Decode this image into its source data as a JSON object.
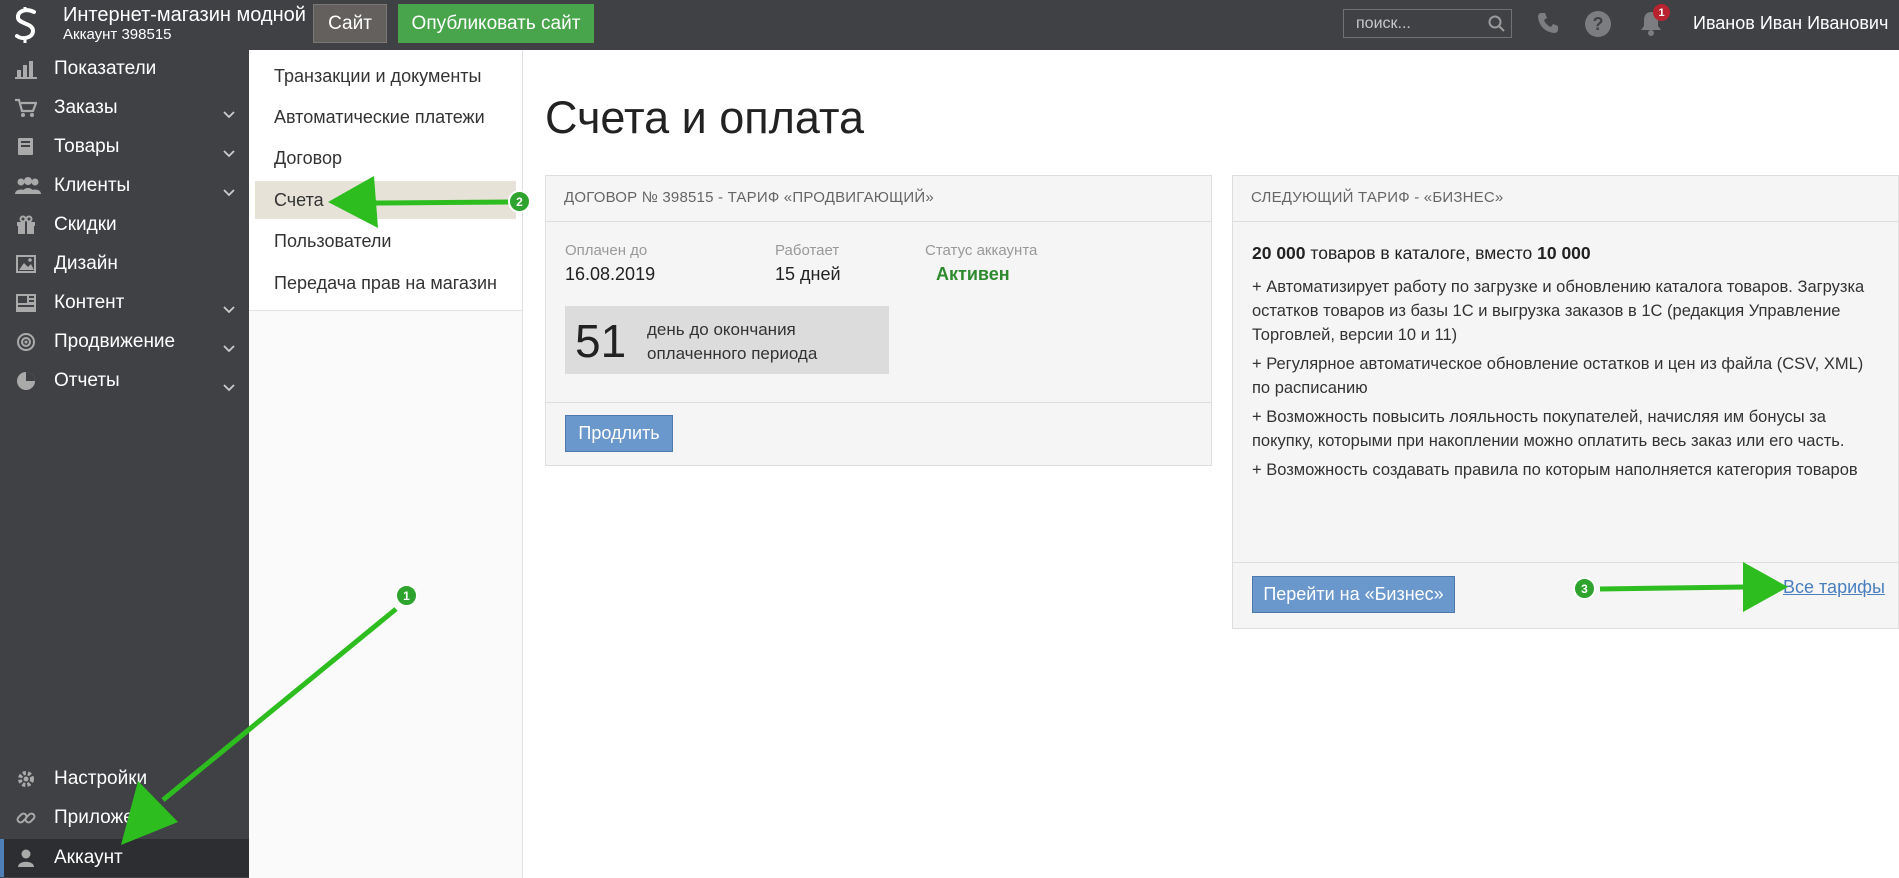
{
  "topbar": {
    "store_name": "Интернет-магазин модной",
    "account_label": "Аккаунт 398515",
    "site_button": "Сайт",
    "publish_button": "Опубликовать сайт",
    "search_placeholder": "поиск...",
    "notifications_count": "1",
    "user_name": "Иванов Иван Иванович"
  },
  "sidebar": {
    "items": [
      {
        "label": "Показатели",
        "icon": "chart-icon"
      },
      {
        "label": "Заказы",
        "icon": "cart-icon"
      },
      {
        "label": "Товары",
        "icon": "book-icon"
      },
      {
        "label": "Клиенты",
        "icon": "users-icon"
      },
      {
        "label": "Скидки",
        "icon": "gift-icon"
      },
      {
        "label": "Дизайн",
        "icon": "image-icon"
      },
      {
        "label": "Контент",
        "icon": "dashboard-icon"
      },
      {
        "label": "Продвижение",
        "icon": "target-icon"
      },
      {
        "label": "Отчеты",
        "icon": "pie-icon"
      }
    ],
    "bottom_items": [
      {
        "label": "Настройки",
        "icon": "gear-icon"
      },
      {
        "label": "Приложения",
        "icon": "link-icon"
      },
      {
        "label": "Аккаунт",
        "icon": "user-icon"
      }
    ]
  },
  "submenu": {
    "items": [
      "Транзакции и документы",
      "Автоматические платежи",
      "Договор",
      "Счета",
      "Пользователи",
      "Передача прав на магазин"
    ],
    "active": "Счета"
  },
  "main": {
    "title": "Счета и оплата",
    "contract": {
      "header": "Договор № 398515 - тариф «Продвигающий»",
      "paid_until_label": "Оплачен до",
      "paid_until_value": "16.08.2019",
      "works_label": "Работает",
      "works_value": "15 дней",
      "status_label": "Статус аккаунта",
      "status_value": "Активен",
      "days_left_number": "51",
      "days_left_text": "день до окончания оплаченного периода",
      "extend_button": "Продлить"
    },
    "next_tariff": {
      "header": "Следующий тариф - «Бизнес»",
      "lead_num1": "20 000",
      "lead_mid": " товаров в каталоге, вместо ",
      "lead_num2": "10 000",
      "features": [
        "+ Автоматизирует работу по загрузке и обновлению каталога товаров. Загрузка остатков товаров из базы 1С и выгрузка заказов в 1С (редакция Управление Торговлей, версии 10 и 11)",
        "+ Регулярное автоматическое обновление остатков и цен из файла (CSV, XML) по расписанию",
        "+ Возможность повысить лояльность покупателей, начисляя им бонусы за покупку, которыми при накоплении можно оплатить весь заказ или его часть.",
        "+ Возможность создавать правила по которым наполняется категория товаров"
      ],
      "go_button": "Перейти на «Бизнес»",
      "all_tariffs_link": "Все тарифы"
    }
  },
  "annotations": {
    "marker1": "1",
    "marker2": "2",
    "marker3": "3"
  },
  "colors": {
    "sidebar_bg": "#3f4145",
    "publish_green": "#49a54b",
    "button_blue": "#6a97cc",
    "status_green": "#2e8a2e",
    "arrow_green": "#2ebd1f"
  }
}
